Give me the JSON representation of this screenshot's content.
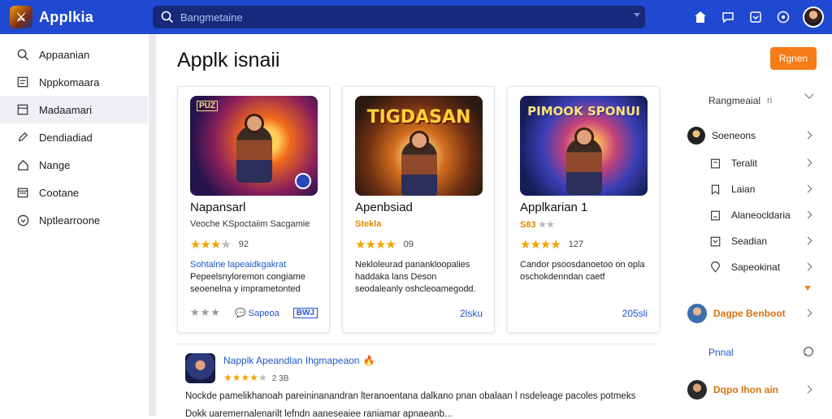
{
  "app": {
    "name": "Applkia"
  },
  "search": {
    "placeholder": "Bangmetaine"
  },
  "sidebar": {
    "items": [
      {
        "label": "Appaanian",
        "icon": "search-icon"
      },
      {
        "label": "Nppkomaara",
        "icon": "list-icon"
      },
      {
        "label": "Madaamari",
        "icon": "category-icon",
        "active": true
      },
      {
        "label": "Dendiadiad",
        "icon": "edit-icon"
      },
      {
        "label": "Nange",
        "icon": "home-icon"
      },
      {
        "label": "Cootane",
        "icon": "calendar-icon"
      },
      {
        "label": "Nptlearroone",
        "icon": "info-circle-icon"
      }
    ]
  },
  "main": {
    "title": "Applk isnaii",
    "primary_button": "Rgnen"
  },
  "cards": [
    {
      "art_corner": "PUZ",
      "title": "Napansarl",
      "subtitle": "Veoche KSpoctaiim Sacgamie",
      "rating": 3,
      "rating_count": "92",
      "desc_link": "Sohtalne lapeaidkgakrat",
      "desc": "Pepeelsnyloremon congiame seoenelna y imprametonted",
      "foot_stars": "★★★",
      "foot_link": "Sapeoa",
      "foot_badge": "BWJ"
    },
    {
      "art_title": "TIGDASAN",
      "title": "Apenbsiad",
      "subtitle": "Stekla",
      "rating": 4,
      "rating_count": "09",
      "desc": "Nekloleurad panankloopalies haddaka lans Deson seodaleanly oshcleoamegodd.",
      "price": "2lsku"
    },
    {
      "art_title": "PIMOOK SPONUI",
      "title": "Applkarian 1",
      "subtitle": "S83",
      "rating": 4,
      "rating_count": "127",
      "desc": "Candor psoosdanoetoo on opla oschokdenndan caetf",
      "price": "205sli"
    }
  ],
  "list_item": {
    "title": "Napplk Apeandlan Ihgmapeaon",
    "rating_count": "2 3B",
    "desc_line1": "Nockde pamelikhanoah pareininanandran lteranoentana dalkano pnan obalaan l nsdeleage pacoles potmeks",
    "desc_line2": "Dokk uaremernalenarilt lefndn aaneseaiee raniamar apnaeanb..."
  },
  "right_panel": {
    "header": "Rangmeaial",
    "header_small": "ri",
    "items": [
      {
        "label": "Soeneons",
        "icon": "user-avatar"
      },
      {
        "label": "Teralit",
        "icon": "document-icon"
      },
      {
        "label": "Laian",
        "icon": "bookmark-icon"
      },
      {
        "label": "Alaneocldaria",
        "icon": "flag-icon"
      },
      {
        "label": "Seadian",
        "icon": "chevron-box-icon"
      },
      {
        "label": "Sapeokinat",
        "icon": "location-icon"
      }
    ],
    "people": [
      {
        "name": "Dagpe Benboot"
      },
      {
        "name": "Dqpo Ihon ain"
      }
    ],
    "link": "Pnnal"
  },
  "colors": {
    "topbar": "#1f49d1",
    "accent_orange": "#f57c17",
    "link_blue": "#2156c9",
    "star": "#f0a500"
  }
}
